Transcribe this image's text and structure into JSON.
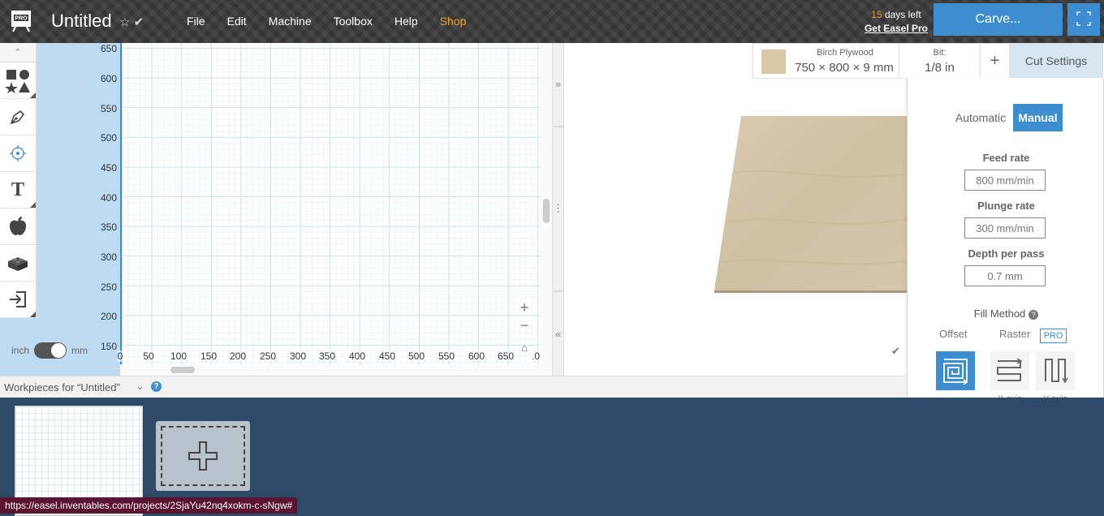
{
  "header": {
    "logo_badge": "PRO",
    "title": "Untitled",
    "menu": [
      "File",
      "Edit",
      "Machine",
      "Toolbox",
      "Help",
      "Shop"
    ],
    "trial_days": "15",
    "trial_suffix": " days left",
    "trial_link": "Get Easel Pro",
    "carve_label": "Carve..."
  },
  "toolbar": {
    "tools": [
      "shapes-icon",
      "pen-icon",
      "target-icon",
      "text-icon",
      "apple-icon",
      "lego-icon",
      "import-icon"
    ]
  },
  "units": {
    "left": "inch",
    "right": "mm",
    "selected": "mm"
  },
  "canvas": {
    "y_labels": [
      "650",
      "600",
      "550",
      "500",
      "450",
      "400",
      "350",
      "300",
      "250",
      "200",
      "150"
    ],
    "x_labels": [
      "0",
      "50",
      "100",
      "150",
      "200",
      "250",
      "300",
      "350",
      "400",
      "450",
      "500",
      "550",
      "600",
      "650",
      ".0"
    ]
  },
  "material": {
    "name": "Birch Plywood",
    "dimensions": "750 × 800 × 9 mm",
    "bit_label": "Bit:",
    "bit_value": "1/8 in",
    "add_label": "+",
    "cut_settings_tab": "Cut Settings",
    "swatch_color": "#d9c8a4"
  },
  "cut_settings": {
    "mode_auto": "Automatic",
    "mode_manual": "Manual",
    "feed_rate_label": "Feed rate",
    "feed_rate_value": "800 mm/min",
    "plunge_rate_label": "Plunge rate",
    "plunge_rate_value": "300 mm/min",
    "depth_label": "Depth per pass",
    "depth_value": "0.7 mm",
    "fill_method_label": "Fill Method",
    "fill_offset": "Offset",
    "fill_raster": "Raster",
    "pro_badge": "PRO",
    "x_axis": "X axis",
    "y_axis": "Y axis"
  },
  "workpieces": {
    "title": "Workpieces for “Untitled”"
  },
  "status_url": "https://easel.inventables.com/projects/2SjaYu42nq4xokm-c-sNgw#",
  "colors": {
    "accent": "#3d8ed0",
    "shop": "#f0a42a",
    "header_bg": "#3a3a3a",
    "workpiece_bg": "#2d4a66"
  }
}
